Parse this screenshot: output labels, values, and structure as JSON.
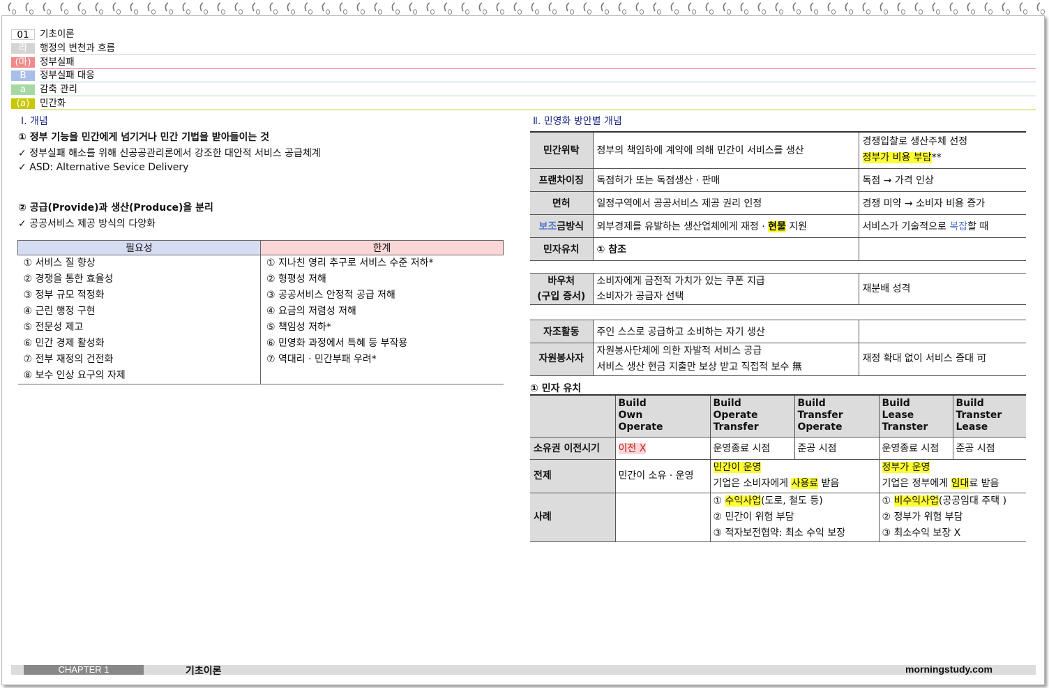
{
  "header": {
    "rows": [
      {
        "tag": "01",
        "label": "기초이론",
        "color": "#d4d4d4",
        "tagColor": "#ffffff",
        "tagText": "#000000"
      },
      {
        "tag": "라",
        "label": "행정의 변천과 흐름",
        "color": "#d4d4d4",
        "tagColor": "#d4d4d4",
        "tagText": "#ffffff"
      },
      {
        "tag": "(마)",
        "label": "정부실패",
        "color": "#f08a8a",
        "tagColor": "#f08a8a",
        "tagText": "#ffffff"
      },
      {
        "tag": "B",
        "label": "정부실패 대응",
        "color": "#a9bfe8",
        "tagColor": "#a9bfe8",
        "tagText": "#ffffff"
      },
      {
        "tag": "a",
        "label": "감축 관리",
        "color": "#a6d8a6",
        "tagColor": "#a6d8a6",
        "tagText": "#ffffff"
      },
      {
        "tag": "(a)",
        "label": "민간화",
        "color": "#c8c800",
        "tagColor": "#c8c800",
        "tagText": "#ffffff"
      }
    ]
  },
  "left": {
    "section_title": "Ⅰ. 개념",
    "point1": {
      "title": "① 정부 기능을 민간에게 넘기거나 민간 기법을 받아들이는 것",
      "bullets": [
        "정부실패 해소를 위해 신공공관리론에서 강조한 대안적 서비스 공급체계",
        "ASD: Alternative Sevice Delivery"
      ]
    },
    "point2": {
      "title": "② 공급(Provide)과 생산(Produce)을 분리",
      "bullets": [
        "공공서비스 제공 방식의 다양화"
      ]
    },
    "check_mark": "✓",
    "table": {
      "col1_header": "필요성",
      "col2_header": "한계",
      "col1": [
        "① 서비스 질 향상",
        "② 경쟁을 통한 효율성",
        "③ 정부 규모 적정화",
        "④ 근린 행정 구현",
        "⑤ 전문성 제고",
        "⑥ 민간 경제 활성화",
        "⑦ 전부 재정의 건전화",
        "⑧ 보수 인상 요구의 자제"
      ],
      "col2": [
        "① 지나친 영리 추구로 서비스 수준 저하*",
        "② 형평성 저해",
        "③ 공공서비스 안정적 공급 저해",
        "④ 요금의 저렴성 저해",
        "⑤ 책임성 저하*",
        "⑥ 민영화 과정에서 특혜 등 부작용",
        "⑦ 역대리 · 민간부패 우려*"
      ]
    }
  },
  "right": {
    "section_title": "Ⅱ. 민영화 방안별 개념",
    "rows": {
      "contract": {
        "head": "민간위탁",
        "desc": "정부의 책임하에 계약에 의해 민간이 서비스를 생산",
        "note1": "경쟁입찰로 생산주체 선정",
        "note2_hl": "정부가 비용 부담",
        "note2_suffix": "**"
      },
      "franchise": {
        "head": "프랜차이징",
        "desc": "독점허가 또는 독점생산 · 판매",
        "note": "독점 → 가격 인상"
      },
      "license": {
        "head": "면허",
        "desc": "일정구역에서 공공서비스 제공 권리 인정",
        "note": "경쟁 미약 → 소비자 비용 증가"
      },
      "subsidy": {
        "head_blue": "보조",
        "head_rest": "금방식",
        "desc_pre": "외부경제를 유발하는 생산업체에게 재정 · ",
        "desc_hl": "현물",
        "desc_post": " 지원",
        "note_pre": "서비스가 기술적으로 ",
        "note_blue": "복잡",
        "note_post": "할 때"
      },
      "private_invest": {
        "head": "민자유치",
        "desc": "① 참조"
      },
      "voucher": {
        "head1": "바우처",
        "head2": "(구입 증서)",
        "desc1": "소비자에게 금전적 가치가 있는 쿠폰 지급",
        "desc2": "소비자가 공급자 선택",
        "note": "재분배 성격"
      },
      "self_help": {
        "head": "자조활동",
        "desc": "주인 스스로 공급하고 소비하는 자기 생산"
      },
      "volunteer": {
        "head": "자원봉사자",
        "desc1": "자원봉사단체에 의한 자발적 서비스 공급",
        "desc2": "서비스 생산 현금 지출만 보상 받고 직접적 보수 無",
        "note": "재정 확대 없이 서비스 증대 可"
      }
    },
    "bt": {
      "title": "① 민자 유치",
      "cols": [
        [
          "Build",
          "Own",
          "Operate"
        ],
        [
          "Build",
          "Operate",
          "Transfer"
        ],
        [
          "Build",
          "Transfer",
          "Operate"
        ],
        [
          "Build",
          "Lease",
          "Transter"
        ],
        [
          "Build",
          "Transter",
          "Lease"
        ]
      ],
      "ownership": {
        "head": "소유권 이전시기",
        "v1": "이전 X",
        "v2": "운영종료 시점",
        "v3": "준공 시점",
        "v4": "운영종료 시점",
        "v5": "준공 시점"
      },
      "premise": {
        "head": "전제",
        "v1": "민간이 소유 · 운영",
        "m_hl": "민간이 운영",
        "m_pre": "기업은 소비자에게 ",
        "m_hl2": "사용료",
        "m_post": " 받음",
        "g_hl": "정부가 운영",
        "g_pre": "기업은 정부에게 ",
        "g_hl2": "임대",
        "g_post": "료 받음"
      },
      "cases": {
        "head": "사례",
        "m1_pre": "① ",
        "m1_hl": "수익사업",
        "m1_post": "(도로, 철도 등)",
        "m2": "② 민간이 위험 부담",
        "m3": "③ 적자보전협약: 최소 수익 보장",
        "g1_pre": "① ",
        "g1_hl": "비수익사업",
        "g1_post": "(공공임대 주택 )",
        "g2": "② 정부가 위험 부담",
        "g3": "③ 최소수익 보장 X"
      }
    }
  },
  "footer": {
    "chapter": "CHAPTER 1",
    "title": "기초이론",
    "url": "morningstudy.com"
  }
}
